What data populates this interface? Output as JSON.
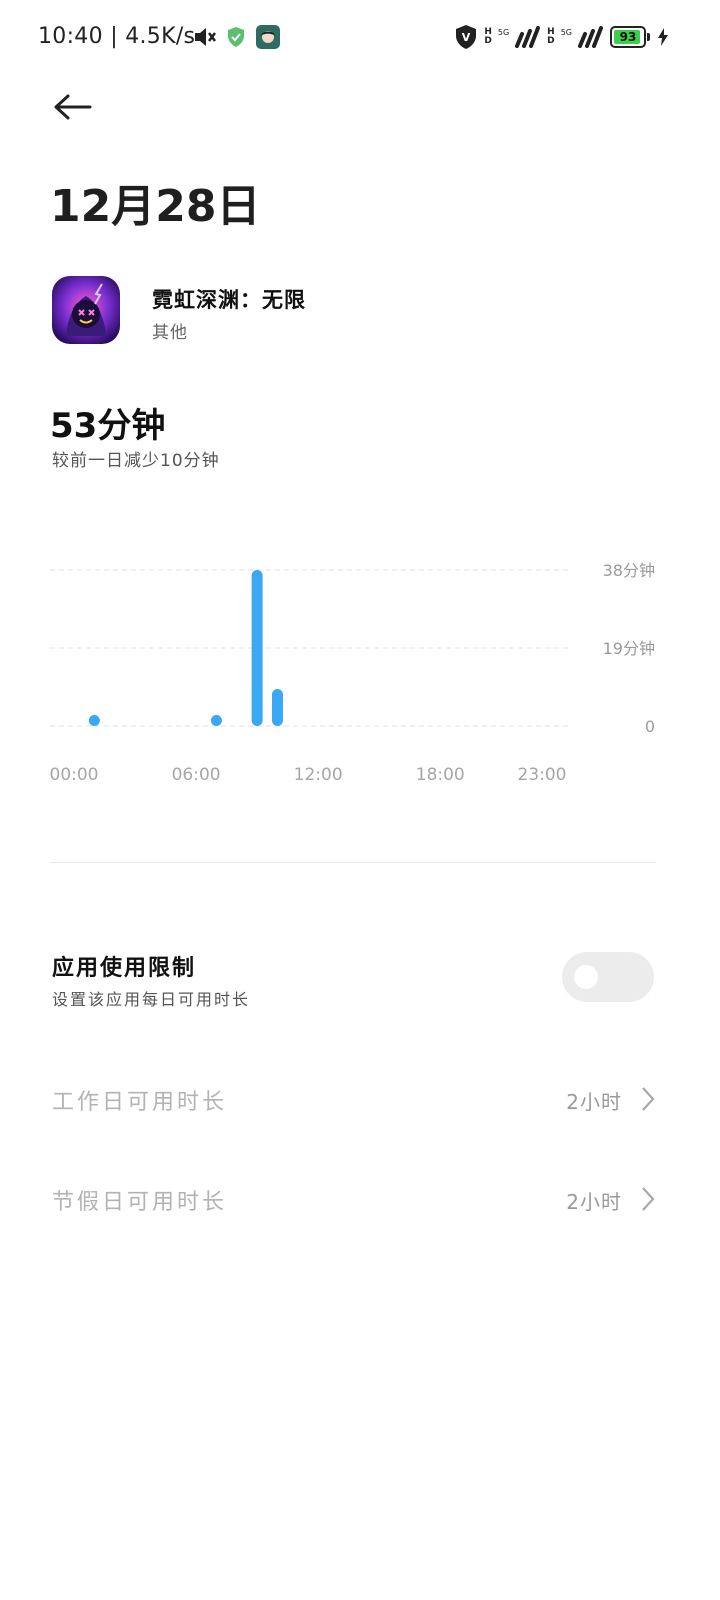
{
  "status_bar": {
    "time": "10:40",
    "speed": "4.5K/s",
    "battery": "93",
    "battery_level": 0.93,
    "hd_label_top": "H",
    "hd_label_bottom": "D",
    "net_label": "5G",
    "icons": [
      "mute-icon",
      "shield-check-icon",
      "avatar-icon",
      "vpn-icon",
      "signal-icon",
      "signal-icon",
      "battery-icon",
      "charging-icon"
    ]
  },
  "header": {
    "date": "12月28日"
  },
  "app": {
    "name": "霓虹深渊：无限",
    "category": "其他"
  },
  "usage": {
    "total": "53分钟",
    "compare": "较前一日减少10分钟"
  },
  "chart_data": {
    "type": "bar",
    "x_tick_labels": [
      "00:00",
      "06:00",
      "12:00",
      "18:00",
      "23:00"
    ],
    "y_tick_labels": [
      "38分钟",
      "19分钟",
      "0"
    ],
    "ylim": [
      0,
      38
    ],
    "bars": [
      {
        "hour": 1,
        "minutes": 1
      },
      {
        "hour": 7,
        "minutes": 1
      },
      {
        "hour": 9,
        "minutes": 38
      },
      {
        "hour": 10,
        "minutes": 9
      }
    ],
    "color": "#3aa8f5",
    "grid": "dashed-horizontal"
  },
  "limit": {
    "title": "应用使用限制",
    "subtitle": "设置该应用每日可用时长",
    "enabled": false
  },
  "rows": [
    {
      "label": "工作日可用时长",
      "value": "2小时"
    },
    {
      "label": "节假日可用时长",
      "value": "2小时"
    }
  ]
}
